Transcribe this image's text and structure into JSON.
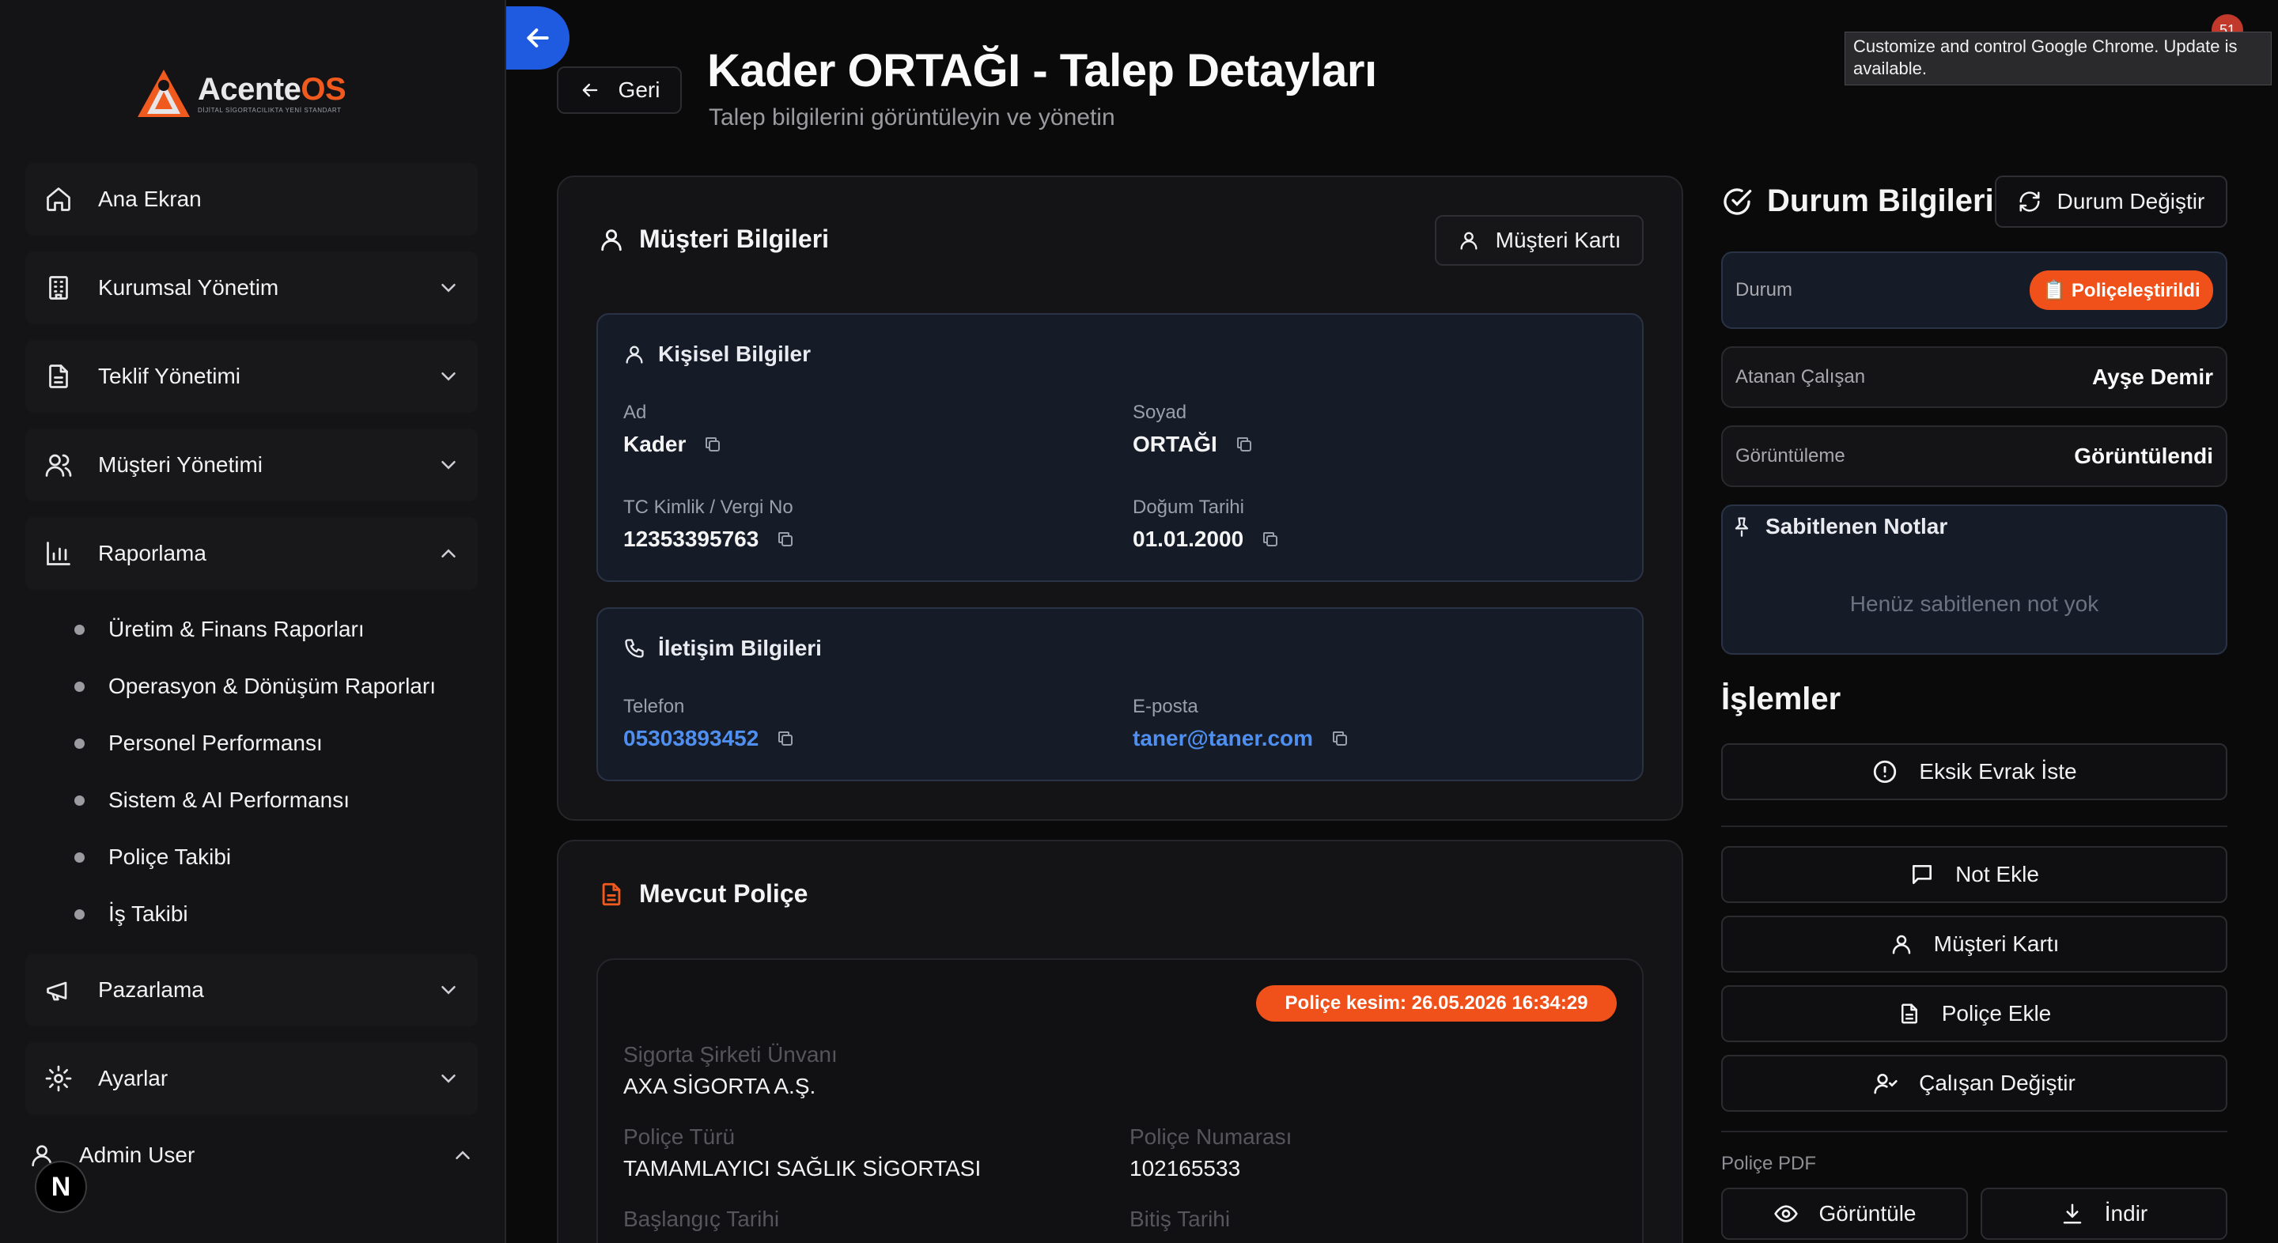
{
  "sidebar": {
    "logo": {
      "name_main": "Acente",
      "name_accent": "OS",
      "tagline": "DİJİTAL SİGORTACILIKTA YENİ STANDART"
    },
    "items": [
      {
        "label": "Ana Ekran",
        "icon": "home-icon"
      },
      {
        "label": "Kurumsal Yönetim",
        "icon": "building-icon"
      },
      {
        "label": "Teklif Yönetimi",
        "icon": "document-icon"
      },
      {
        "label": "Müşteri Yönetimi",
        "icon": "users-icon"
      },
      {
        "label": "Raporlama",
        "icon": "bar-chart-icon",
        "expanded": true
      },
      {
        "label": "Pazarlama",
        "icon": "megaphone-icon"
      },
      {
        "label": "Ayarlar",
        "icon": "gear-icon"
      }
    ],
    "reports_sub": [
      "Üretim & Finans Raporları",
      "Operasyon & Dönüşüm Raporları",
      "Personel Performansı",
      "Sistem & AI Performansı",
      "Poliçe Takibi",
      "İş Takibi"
    ],
    "user": {
      "label": "Admin User"
    },
    "dev_badge": "N"
  },
  "header": {
    "back_label": "Geri",
    "title": "Kader ORTAĞI - Talep Detayları",
    "subtitle": "Talep bilgilerini görüntüleyin ve yönetin"
  },
  "customer": {
    "title": "Müşteri Bilgileri",
    "card_button": "Müşteri Kartı",
    "personal": {
      "title": "Kişisel Bilgiler",
      "first_name_label": "Ad",
      "first_name": "Kader",
      "last_name_label": "Soyad",
      "last_name": "ORTAĞI",
      "id_label": "TC Kimlik / Vergi No",
      "id": "12353395763",
      "birth_label": "Doğum Tarihi",
      "birth": "01.01.2000"
    },
    "contact": {
      "title": "İletişim Bilgileri",
      "phone_label": "Telefon",
      "phone": "05303893452",
      "email_label": "E-posta",
      "email": "taner@taner.com"
    }
  },
  "policy": {
    "title": "Mevcut Poliçe",
    "issued_badge": "Poliçe kesim: 26.05.2026 16:34:29",
    "company_label": "Sigorta Şirketi Ünvanı",
    "company": "AXA SİGORTA A.Ş.",
    "type_label": "Poliçe Türü",
    "type": "TAMAMLAYICI SAĞLIK SİGORTASI",
    "number_label": "Poliçe Numarası",
    "number": "102165533",
    "start_label": "Başlangıç Tarihi",
    "end_label": "Bitiş Tarihi"
  },
  "status": {
    "title": "Durum Bilgileri",
    "change_button": "Durum Değiştir",
    "status_label": "Durum",
    "status_value": "📋 Poliçeleştirildi",
    "assignee_label": "Atanan Çalışan",
    "assignee": "Ayşe Demir",
    "view_label": "Görüntüleme",
    "view_value": "Görüntülendi",
    "notes_title": "Sabitlenen Notlar",
    "notes_empty": "Henüz sabitlenen not yok"
  },
  "actions": {
    "title": "İşlemler",
    "missing_docs": "Eksik Evrak İste",
    "add_note": "Not Ekle",
    "customer_card": "Müşteri Kartı",
    "add_policy": "Poliçe Ekle",
    "change_employee": "Çalışan Değiştir",
    "pdf_label": "Poliçe PDF",
    "view_pdf": "Görüntüle",
    "download_pdf": "İndir"
  },
  "browser": {
    "tooltip": "Customize and control Google Chrome. Update is available.",
    "badge": "51"
  },
  "colors": {
    "accent": "#f0501a",
    "brand_blue": "#1f5be0",
    "link": "#4f8ff0"
  }
}
